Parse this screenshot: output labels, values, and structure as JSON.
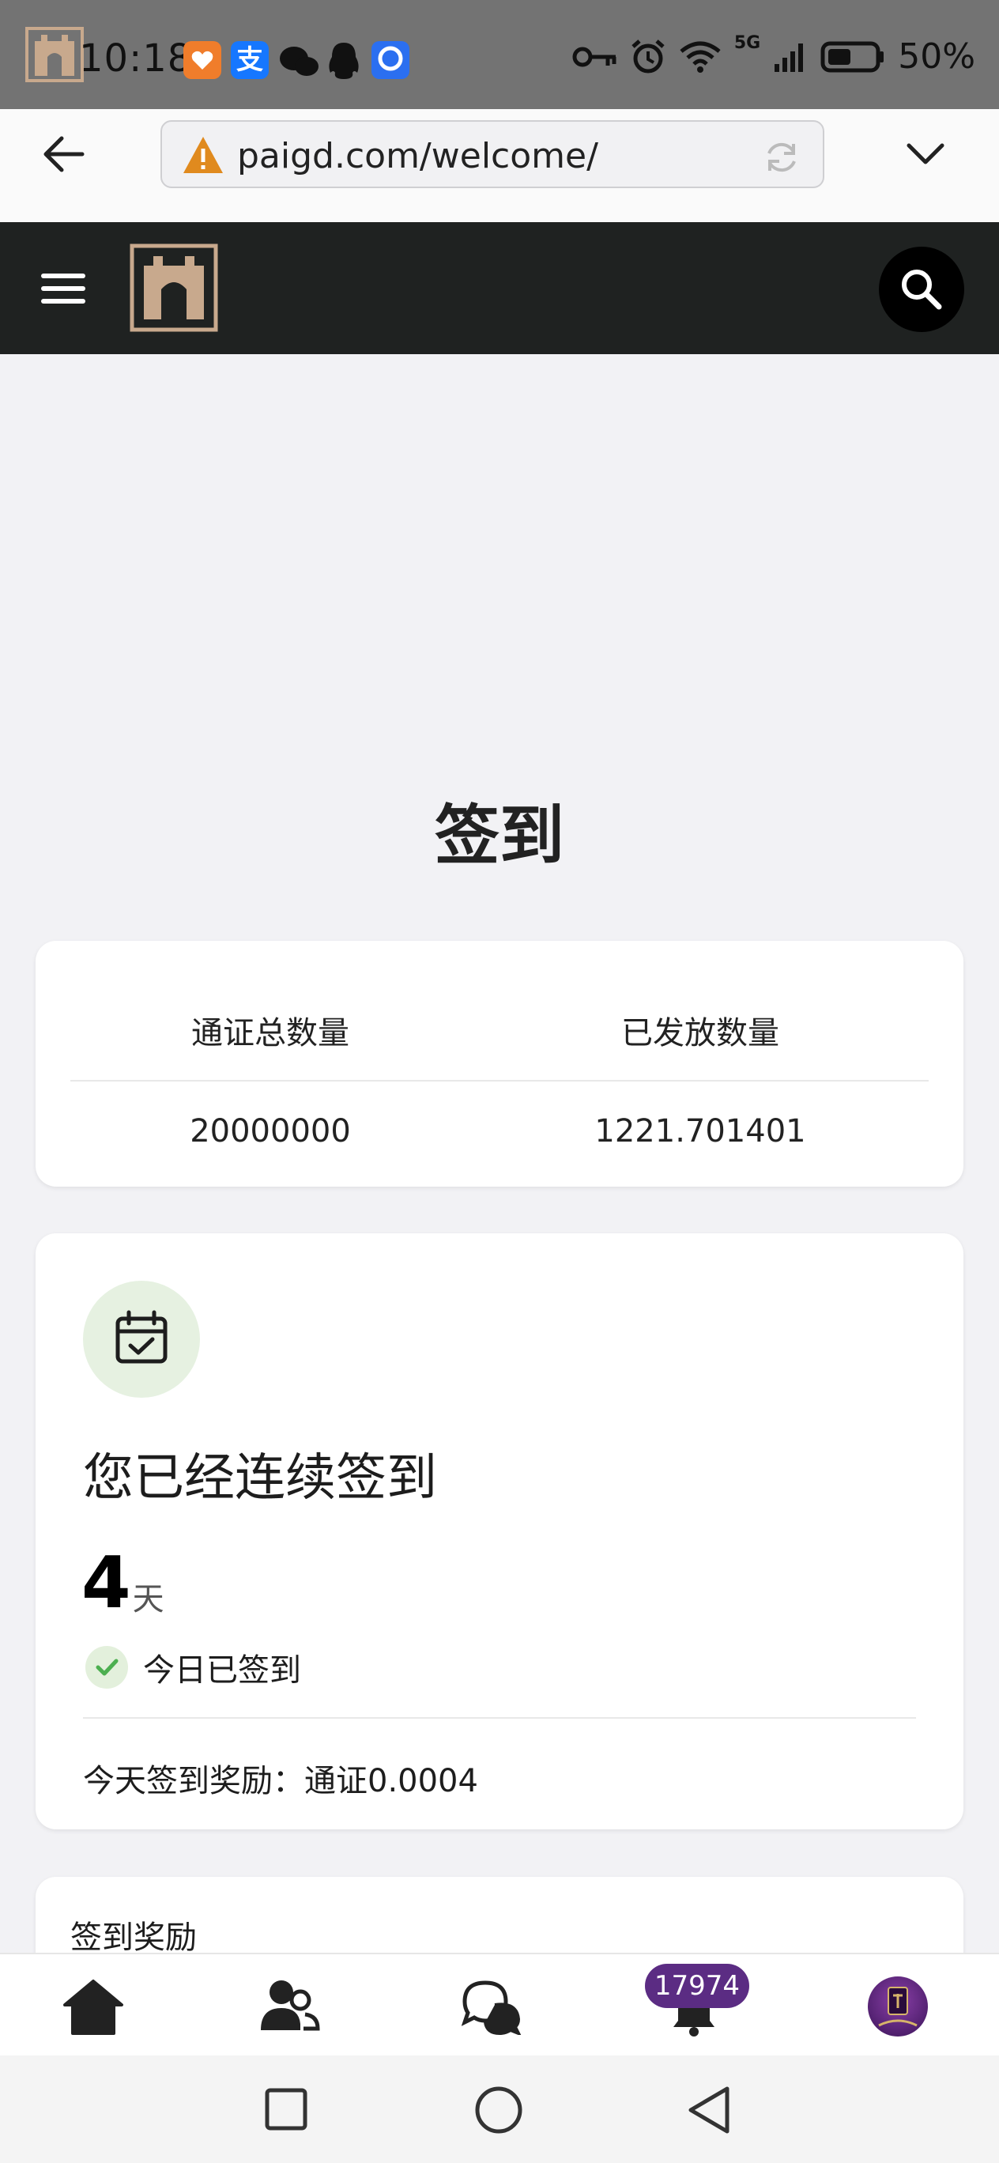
{
  "status_bar": {
    "time": "10:18",
    "signal_label": "5G",
    "battery": "50%"
  },
  "browser": {
    "url": "paigd.com/welcome/"
  },
  "page": {
    "title": "签到",
    "stats": {
      "headers": [
        "通证总数量",
        "已发放数量"
      ],
      "values": [
        "20000000",
        "1221.701401"
      ]
    },
    "streak": {
      "heading": "您已经连续签到",
      "days": "4",
      "days_unit": "天",
      "status": "今日已签到",
      "reward_text": "今天签到奖励：通证0.0004"
    },
    "rewards_section_title": "签到奖励"
  },
  "bottom_nav": {
    "badge_count": "17974"
  },
  "colors": {
    "header_bg": "#1f2221",
    "logo_color": "#c8a98d",
    "badge_bg": "#5b2c83",
    "check_green": "#4caf50"
  }
}
